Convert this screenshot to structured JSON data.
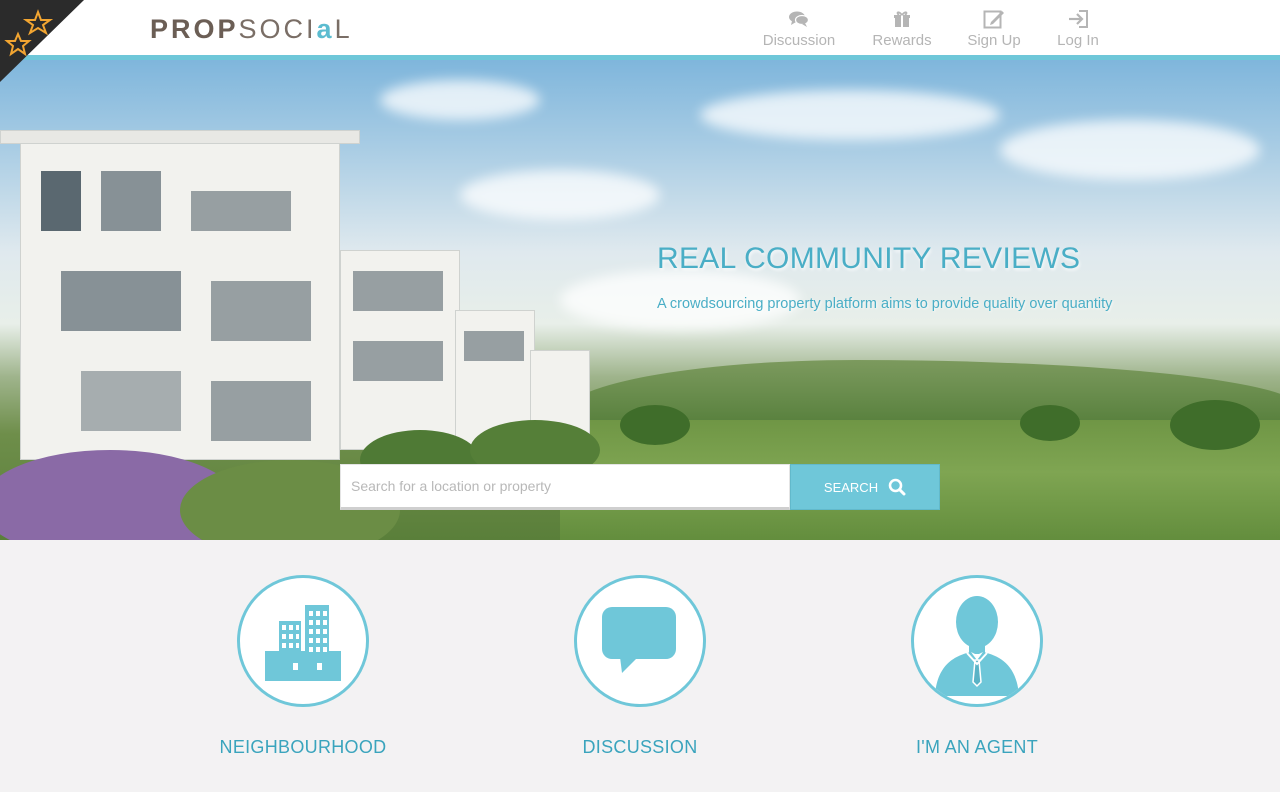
{
  "brand": {
    "logo_prop": "PROP",
    "logo_social_a": "SOCI",
    "logo_a": "a",
    "logo_social_b": "L",
    "accent_color": "#6fc7d9",
    "text_accent": "#4aaec6"
  },
  "nav": {
    "items": [
      {
        "label": "Discussion",
        "icon": "chat-bubbles-icon"
      },
      {
        "label": "Rewards",
        "icon": "gift-icon"
      },
      {
        "label": "Sign Up",
        "icon": "edit-icon"
      },
      {
        "label": "Log In",
        "icon": "login-icon"
      }
    ]
  },
  "hero": {
    "title": "REAL COMMUNITY REVIEWS",
    "subtitle": "A crowdsourcing property platform aims to provide quality over quantity"
  },
  "search": {
    "placeholder": "Search for a location or property",
    "value": "",
    "button_label": "SEARCH",
    "button_icon": "search-icon"
  },
  "features": [
    {
      "label": "NEIGHBOURHOOD",
      "icon": "buildings-icon"
    },
    {
      "label": "DISCUSSION",
      "icon": "speech-bubble-icon"
    },
    {
      "label": "I'M AN AGENT",
      "icon": "agent-person-icon"
    }
  ]
}
